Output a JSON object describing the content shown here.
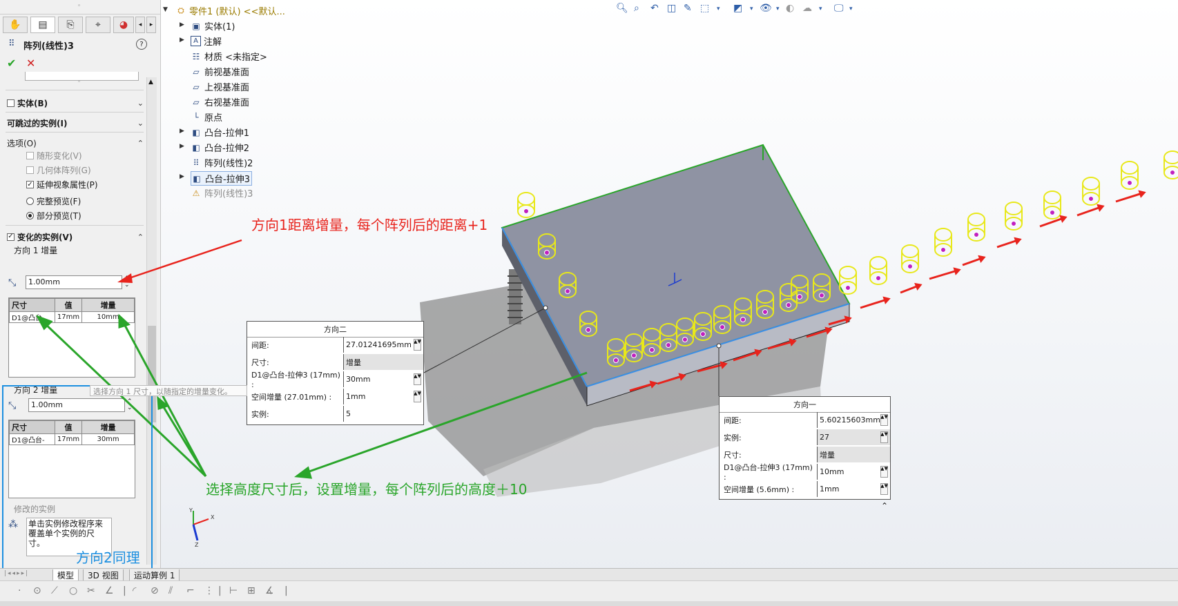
{
  "feature_manager": {
    "title": "阵列(线性)3",
    "ok_label": "✔",
    "cancel_label": "✕",
    "help_label": "?",
    "sections": {
      "bodies": "实体(B)",
      "skip_instances": "可跳过的实例(I)",
      "options": "选项(O)",
      "varied_instances": "变化的实例(V)"
    },
    "options": {
      "vary_sketch": "随形变化(V)",
      "geometry_pattern": "几何体阵列(G)",
      "propagate_visual": "延伸视象属性(P)",
      "full_preview": "完整预览(F)",
      "partial_preview": "部分预览(T)"
    },
    "direction1": {
      "label": "方向 1 增量",
      "increment": "1.00mm",
      "table_headers": [
        "尺寸",
        "值",
        "增量"
      ],
      "table_row": [
        "D1@凸台-",
        "17mm",
        "10mm"
      ]
    },
    "direction2": {
      "label": "方向 2 增量",
      "increment": "1.00mm",
      "table_headers": [
        "尺寸",
        "值",
        "增量"
      ],
      "table_row": [
        "D1@凸台-",
        "17mm",
        "30mm"
      ]
    },
    "tooltip": "选择方向 1 尺寸，以随指定的增量变化。",
    "modified_instances_label": "修改的实例",
    "modified_instances_text": "单击实例修改程序来覆盖单个实例的尺寸。"
  },
  "tree": {
    "root": "零件1 (默认) <<默认...",
    "items": [
      "实体(1)",
      "注解",
      "材质 <未指定>",
      "前视基准面",
      "上视基准面",
      "右视基准面",
      "原点",
      "凸台-拉伸1",
      "凸台-拉伸2",
      "阵列(线性)2",
      "凸台-拉伸3",
      "阵列(线性)3"
    ]
  },
  "dialog_dir2": {
    "title": "方向二",
    "rows": [
      {
        "label": "间距:",
        "value": "27.01241695mm"
      },
      {
        "label": "尺寸:",
        "value": "增量"
      },
      {
        "label": "D1@凸台-拉伸3 (17mm) :",
        "value": "30mm"
      },
      {
        "label": "空间增量 (27.01mm) :",
        "value": "1mm"
      },
      {
        "label": "实例:",
        "value": "5"
      }
    ]
  },
  "dialog_dir1": {
    "title": "方向一",
    "rows": [
      {
        "label": "间距:",
        "value": "5.60215603mm"
      },
      {
        "label": "实例:",
        "value": "27"
      },
      {
        "label": "尺寸:",
        "value": "增量"
      },
      {
        "label": "D1@凸台-拉伸3 (17mm) :",
        "value": "10mm"
      },
      {
        "label": "空间增量 (5.6mm) :",
        "value": "1mm"
      }
    ]
  },
  "annotations": {
    "red": "方向1距离增量，每个阵列后的距离+1",
    "green": "选择高度尺寸后，设置增量，每个阵列后的高度＋10",
    "blue": "方向2同理"
  },
  "bottom_tabs": [
    "模型",
    "3D 视图",
    "运动算例 1"
  ],
  "colors": {
    "red": "#e8231c",
    "green": "#2aa52a",
    "blue": "#1c8fe0",
    "part": "#8a8f9e",
    "yellow": "#e8e81a",
    "magenta": "#c020c0"
  }
}
